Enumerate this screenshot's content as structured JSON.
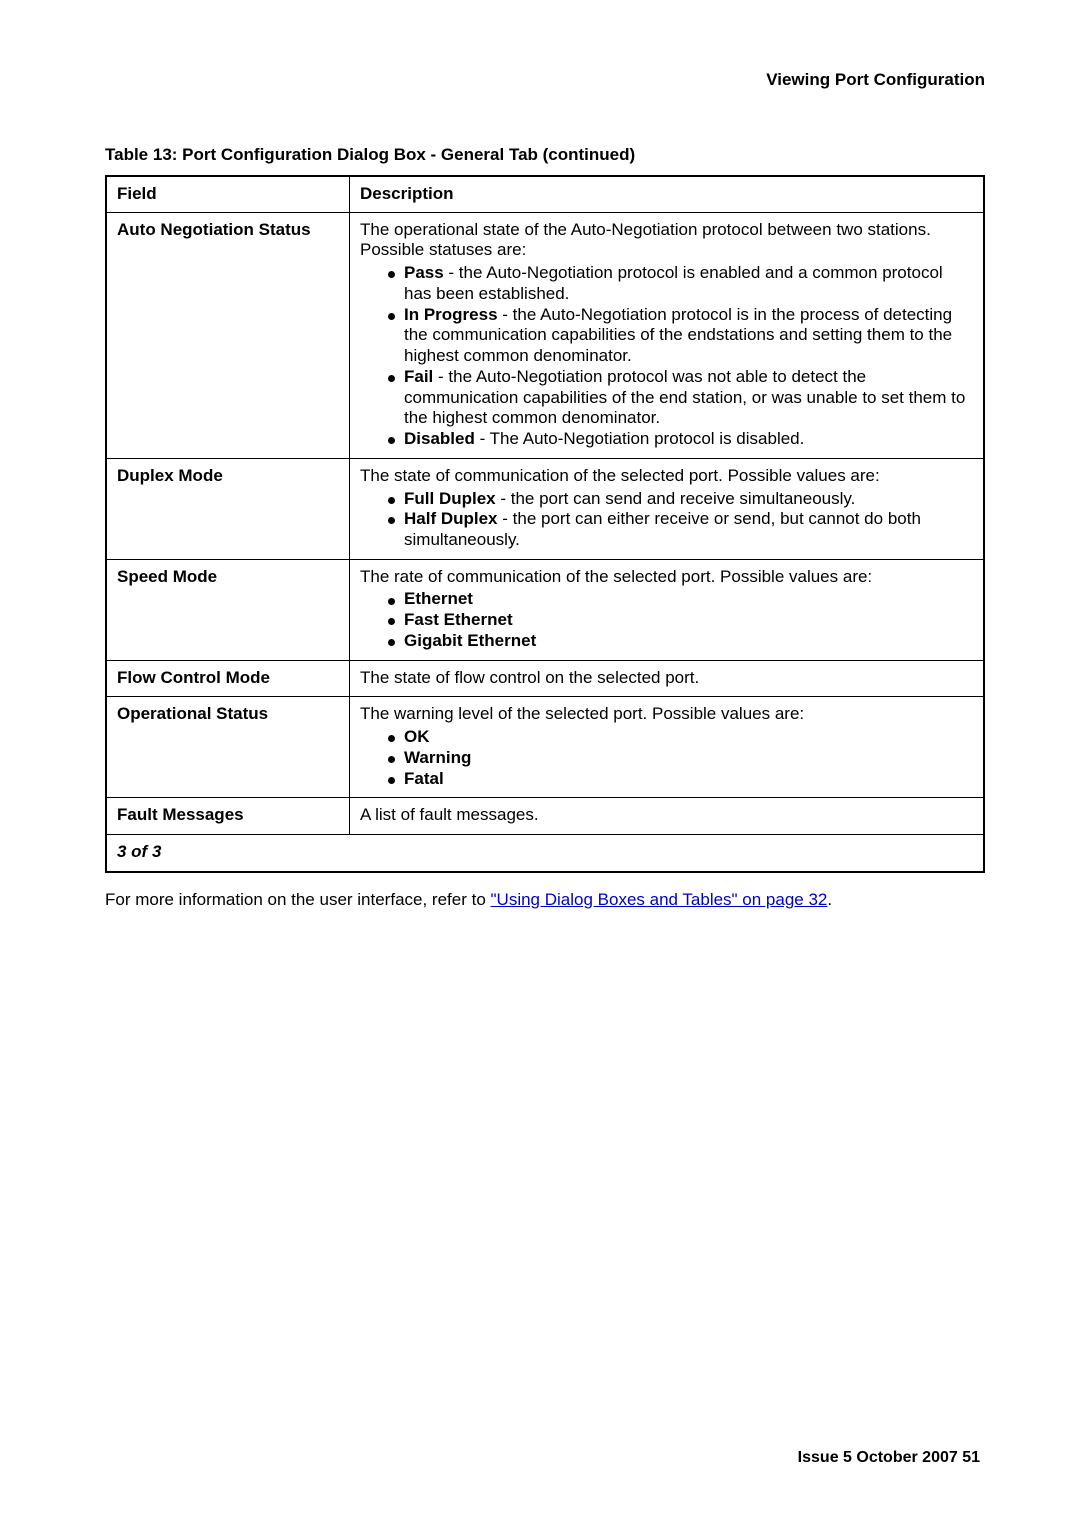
{
  "header": {
    "title": "Viewing Port Configuration"
  },
  "table": {
    "caption": "Table 13: Port Configuration Dialog Box - General Tab (continued)",
    "columns": {
      "field": "Field",
      "description": "Description"
    },
    "rows": [
      {
        "field": "Auto Negotiation Status",
        "lead": "The operational state of the Auto-Negotiation protocol between two stations. Possible statuses are:",
        "bullets": [
          {
            "term": "Pass",
            "rest": " - the Auto-Negotiation protocol is enabled and a common protocol has been established."
          },
          {
            "term": "In Progress",
            "rest": " - the Auto-Negotiation protocol is in the process of detecting the communication capabilities of the endstations and setting them to the highest common denominator."
          },
          {
            "term": "Fail",
            "rest": " - the Auto-Negotiation protocol was not able to detect the communication capabilities of the end station, or was unable to set them to the highest common denominator."
          },
          {
            "term": "Disabled",
            "rest": " - The Auto-Negotiation protocol is disabled."
          }
        ]
      },
      {
        "field": "Duplex Mode",
        "lead": "The state of communication of the selected port. Possible values are:",
        "bullets": [
          {
            "term": "Full Duplex",
            "rest": " - the port can send and receive simultaneously."
          },
          {
            "term": "Half Duplex",
            "rest": " - the port can either receive or send, but cannot do both simultaneously."
          }
        ]
      },
      {
        "field": "Speed Mode",
        "lead": "The rate of communication of the selected port. Possible values are:",
        "bullets": [
          {
            "term": "Ethernet",
            "rest": ""
          },
          {
            "term": "Fast Ethernet",
            "rest": ""
          },
          {
            "term": "Gigabit Ethernet",
            "rest": ""
          }
        ]
      },
      {
        "field": "Flow Control Mode",
        "plain": "The state of flow control on the selected port."
      },
      {
        "field": "Operational Status",
        "lead": "The warning level of the selected port. Possible values are:",
        "bullets": [
          {
            "term": "OK",
            "rest": ""
          },
          {
            "term": "Warning",
            "rest": ""
          },
          {
            "term": "Fatal",
            "rest": ""
          }
        ]
      },
      {
        "field": "Fault Messages",
        "plain": "A list of fault messages."
      }
    ],
    "footer": "3 of 3"
  },
  "body": {
    "pre": "For more information on the user interface, refer to ",
    "link": "\"Using Dialog Boxes and Tables\" on page 32",
    "post": "."
  },
  "pagefoot": "Issue 5   October 2007    51"
}
